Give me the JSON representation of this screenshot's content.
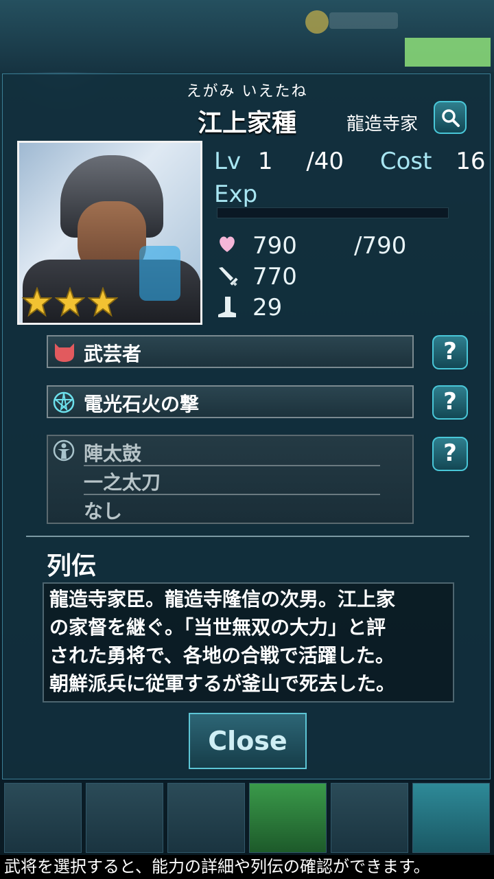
{
  "general": {
    "furigana": "えがみ いえたね",
    "name": "江上家種",
    "clan": "龍造寺家",
    "rarity_stars": 3
  },
  "level": {
    "lv_label": "Lv",
    "lv": "1",
    "max_lv": "/40",
    "cost_label": "Cost",
    "cost": "16",
    "exp_label": "Exp",
    "exp_progress": 0
  },
  "stats": {
    "hp": "790",
    "hp_max": "/790",
    "attack": "770",
    "speed": "29"
  },
  "skills": {
    "type": "武芸者",
    "special": "電光石火の撃",
    "abilities": [
      "陣太鼓",
      "一之太刀",
      "なし"
    ],
    "help_label": "?"
  },
  "biography": {
    "title": "列伝",
    "lines": [
      "龍造寺家臣。龍造寺隆信の次男。江上家",
      "の家督を継ぐ。「当世無双の大力」と評",
      "された勇将で、各地の合戦で活躍した。",
      "朝鮮派兵に従軍するが釜山で死去した。"
    ]
  },
  "close_label": "Close",
  "hint": "武将を選択すると、能力の詳細や列伝の確認ができます。",
  "icons": {
    "search": "search-icon",
    "hp": "heart-icon",
    "attack": "sword-icon",
    "speed": "boot-icon",
    "type": "demon-mask-icon",
    "special": "pentagram-icon",
    "abilities": "person-icon"
  },
  "colors": {
    "accent": "#49c7d8",
    "label": "#a8e6f2",
    "star": "#f2c232"
  }
}
